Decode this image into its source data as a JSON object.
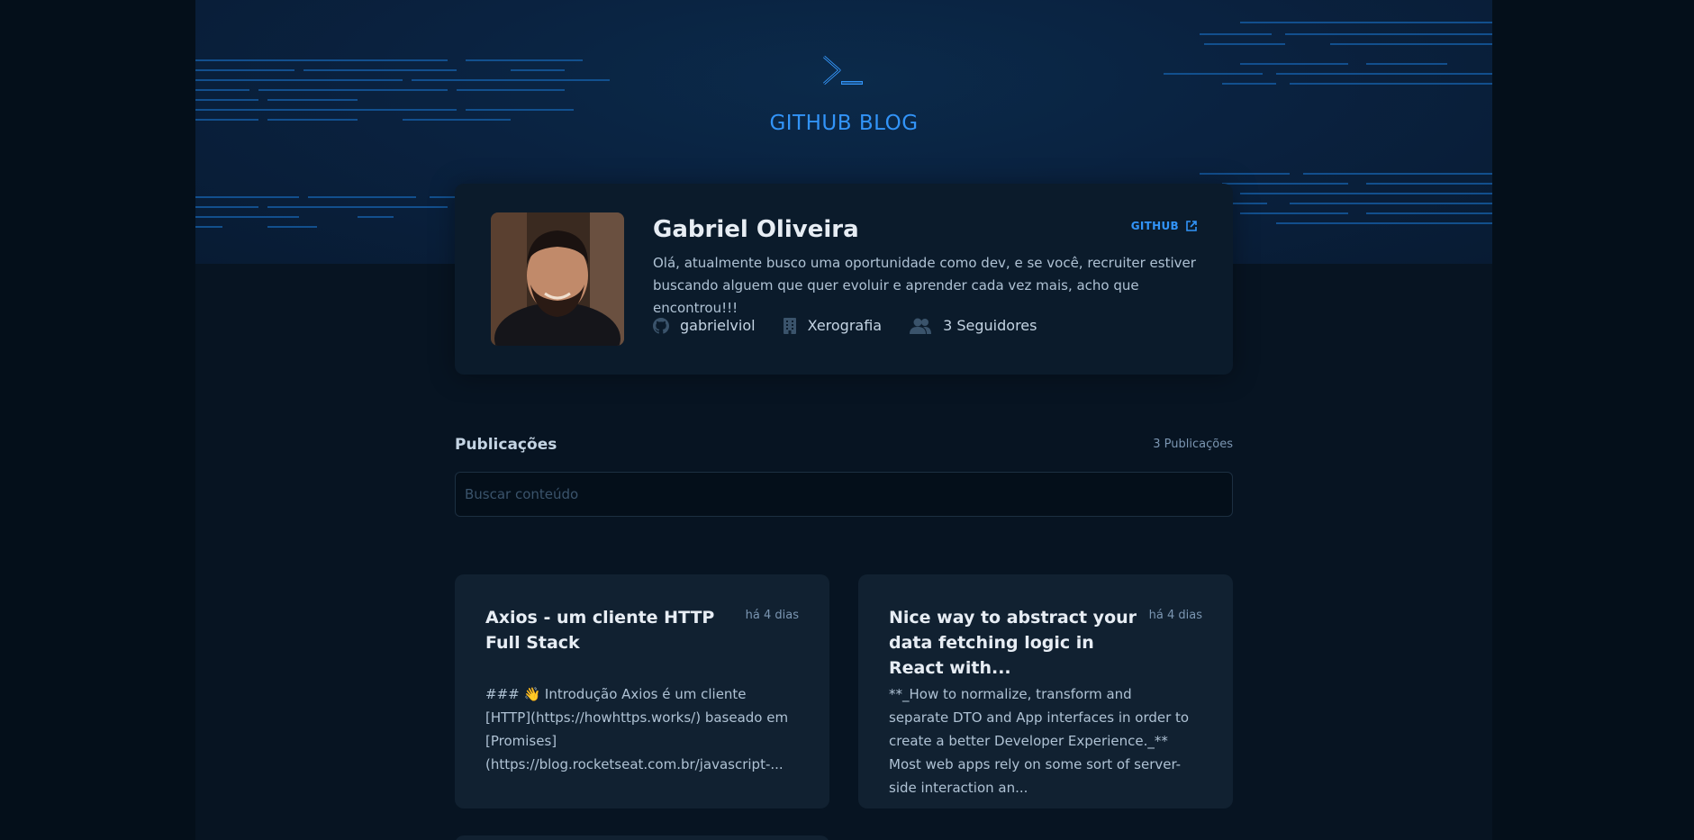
{
  "header": {
    "brand": "GITHUB BLOG",
    "logo_icon": "terminal-prompt-icon"
  },
  "profile": {
    "name": "Gabriel Oliveira",
    "github_link_label": "GITHUB",
    "bio": "Olá, atualmente busco uma oportunidade como dev, e se você, recruiter estiver buscando alguem que quer evoluir e aprender cada vez mais, acho que encontrou!!!",
    "username": "gabrielviol",
    "company": "Xerografia",
    "followers": "3 Seguidores"
  },
  "publications": {
    "title": "Publicações",
    "count_label": "3 Publicações",
    "search_placeholder": "Buscar conteúdo",
    "posts": [
      {
        "title": "Axios - um cliente HTTP Full Stack",
        "date": "há 4 dias",
        "excerpt": "### 👋 Introdução Axios é um cliente [HTTP](https://howhttps.works/) baseado em [Promises](https://blog.rocketseat.com.br/javascript-..."
      },
      {
        "title": "Nice way to abstract your data fetching logic in React with...",
        "date": "há 4 dias",
        "excerpt": "**_How to normalize, transform and separate DTO and App interfaces in order to create a better Developer Experience._** Most web apps rely on some sort of server-side interaction an..."
      }
    ]
  },
  "colors": {
    "page_bg": "#040f1a",
    "accent": "#3294f8",
    "card_bg": "#112131",
    "profile_bg": "#0b1b2b"
  }
}
